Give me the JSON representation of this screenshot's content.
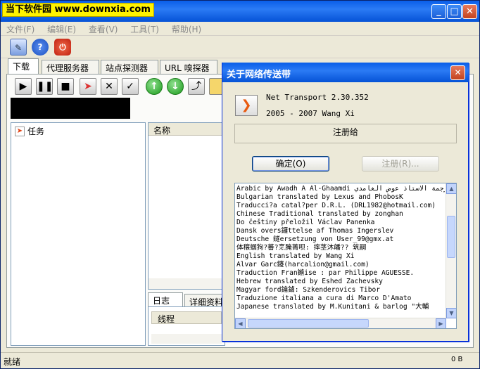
{
  "window": {
    "watermark": "当下软件园 www.downxia.com"
  },
  "menu": [
    "文件(F)",
    "编辑(E)",
    "查看(V)",
    "工具(T)",
    "帮助(H)"
  ],
  "tabs": [
    "下载",
    "代理服务器",
    "站点探测器",
    "URL 嗅探器"
  ],
  "tree": {
    "root": "任务"
  },
  "list": {
    "column_name": "名称"
  },
  "log": {
    "tabs": [
      "日志",
      "详细资料"
    ],
    "column": "线程"
  },
  "status": {
    "text": "就绪"
  },
  "about_dialog": {
    "title": "关于网络传送带",
    "app_name": "Net Transport 2.30.352",
    "copyright": "2005 - 2007 Wang Xi",
    "registered_label": "注册给",
    "ok_button": "确定(O)",
    "register_button": "注册(R)...",
    "credits": [
      "Arabic by Awadh A Al-Ghaamdi ترجمة الاستاذ عوض الغامدي",
      "Bulgarian translated by Lexus and PhobosK",
      "Traducci?a catal?per D.R.L. (DRL1982@hotmail.com)",
      "Chinese Traditional translated by zonghan",
      "Do češtiny přeložil Václav Panenka",
      "Dansk overs鑼ttelse af Thomas Ingerslev",
      "Deutsche 鐩ersetzung von User_99@gmx.at",
      "体穣蝈狗?蕃?烹腌菁呗: 摔茎沐皤?? 筑嗣",
      "English translated by Wang Xi",
      "Alvar Garc鑳(harcalion@gmail.com)",
      "Traduction Fran鏅ise : par Philippe AGUESSE.",
      "Hebrew translated by Eshed Zachevsky",
      "Magyar ford鑰鏀: Szkenderovics Tibor",
      "Traduzione italiana a cura di Marco D'Amato",
      "Japanese translated by M.Kunitani & barlog \"大輔"
    ]
  }
}
